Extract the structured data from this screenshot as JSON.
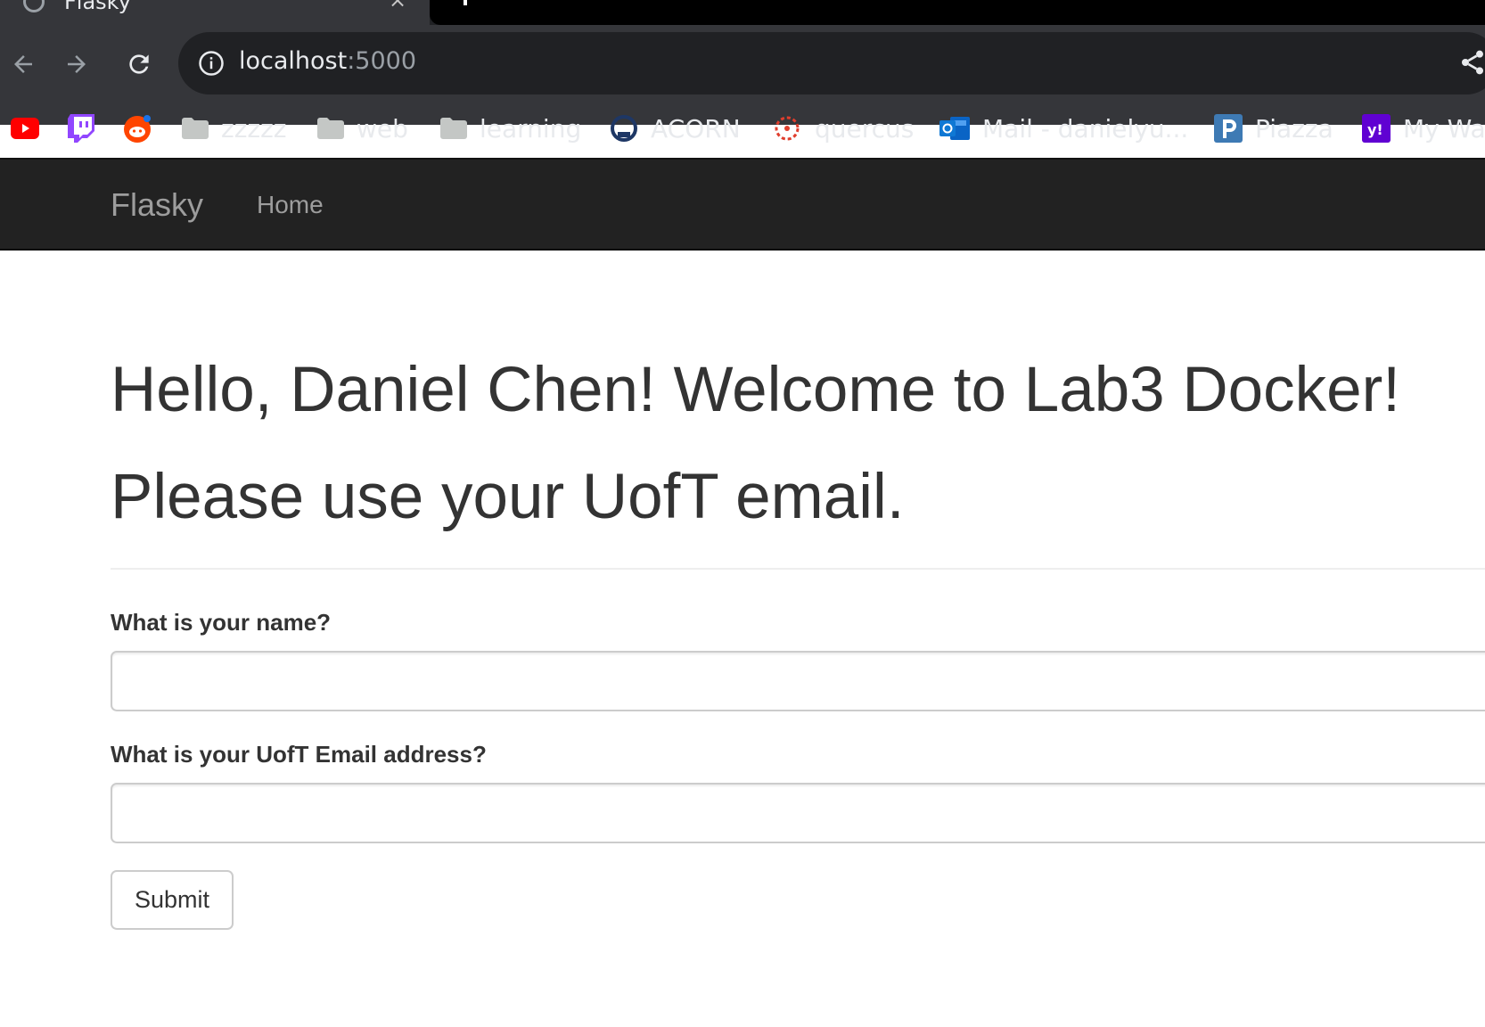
{
  "browser": {
    "tab": {
      "title": "Flasky",
      "close_glyph": "×"
    },
    "address_bar": {
      "host": "localhost",
      "port": ":5000"
    },
    "bookmarks": [
      {
        "icon": "youtube-icon",
        "label": ""
      },
      {
        "icon": "twitch-icon",
        "label": ""
      },
      {
        "icon": "reddit-icon",
        "label": ""
      },
      {
        "icon": "folder-icon",
        "label": "zzzzz"
      },
      {
        "icon": "folder-icon",
        "label": "web"
      },
      {
        "icon": "folder-icon",
        "label": "learning"
      },
      {
        "icon": "acorn-icon",
        "label": "ACORN"
      },
      {
        "icon": "quercus-icon",
        "label": "quercus"
      },
      {
        "icon": "outlook-icon",
        "label": "Mail - danielyu..."
      },
      {
        "icon": "piazza-icon",
        "label": "Piazza"
      },
      {
        "icon": "yahoo-icon",
        "label": "My Wa"
      }
    ],
    "colors": {
      "chrome_bg": "#35363a",
      "omnibox_bg": "#202124",
      "text": "#e8eaed"
    }
  },
  "navbar": {
    "brand": "Flasky",
    "links": [
      {
        "label": "Home"
      }
    ],
    "colors": {
      "bg": "#222222",
      "text": "#9d9d9d"
    }
  },
  "page": {
    "heading_line1": "Hello, Daniel Chen! Welcome to Lab3 Docker!",
    "heading_line2": "Please use your UofT email.",
    "form": {
      "name_label": "What is your name?",
      "name_value": "",
      "email_label": "What is your UofT Email address?",
      "email_value": "",
      "submit_label": "Submit"
    }
  }
}
